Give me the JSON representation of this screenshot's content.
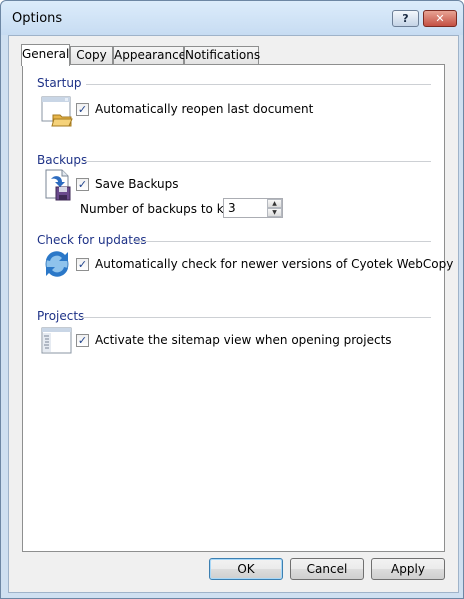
{
  "window": {
    "title": "Options"
  },
  "titlebar": {
    "help_label": "?",
    "close_label": "✕"
  },
  "tabs": [
    {
      "label": "General",
      "active": true
    },
    {
      "label": "Copy",
      "active": false
    },
    {
      "label": "Appearance",
      "active": false
    },
    {
      "label": "Notifications",
      "active": false
    }
  ],
  "sections": {
    "startup": {
      "header": "Startup",
      "icon": "window-folder-icon",
      "checkbox_label": "Automatically reopen last document",
      "checked": true
    },
    "backups": {
      "header": "Backups",
      "icon": "document-disk-icon",
      "checkbox_label": "Save Backups",
      "checked": true,
      "count_label": "Number of backups to keep:",
      "count_value": "3"
    },
    "updates": {
      "header": "Check for updates",
      "icon": "refresh-globe-icon",
      "checkbox_label": "Automatically check for newer versions of Cyotek WebCopy",
      "checked": true
    },
    "projects": {
      "header": "Projects",
      "icon": "sitemap-window-icon",
      "checkbox_label": "Activate the sitemap view when opening projects",
      "checked": true
    }
  },
  "buttons": {
    "ok": "OK",
    "cancel": "Cancel",
    "apply": "Apply"
  },
  "checkmark": "✓"
}
